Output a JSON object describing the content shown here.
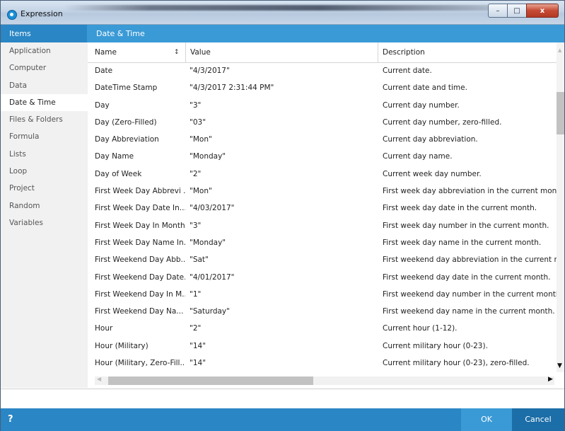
{
  "window": {
    "title": "Expression",
    "minimize_glyph": "–",
    "maximize_glyph": "□",
    "close_glyph": "x"
  },
  "header": {
    "items_label": "Items",
    "section_label": "Date & Time"
  },
  "sidebar": {
    "items": [
      {
        "label": "Application"
      },
      {
        "label": "Computer"
      },
      {
        "label": "Data"
      },
      {
        "label": "Date & Time"
      },
      {
        "label": "Files & Folders"
      },
      {
        "label": "Formula"
      },
      {
        "label": "Lists"
      },
      {
        "label": "Loop"
      },
      {
        "label": "Project"
      },
      {
        "label": "Random"
      },
      {
        "label": "Variables"
      }
    ],
    "selected": "Date & Time"
  },
  "table": {
    "columns": [
      "Name",
      "Value",
      "Description"
    ],
    "rows": [
      {
        "name": "Date",
        "value": "\"4/3/2017\"",
        "description": "Current date."
      },
      {
        "name": "DateTime Stamp",
        "value": "\"4/3/2017 2:31:44 PM\"",
        "description": "Current date and time."
      },
      {
        "name": "Day",
        "value": "\"3\"",
        "description": "Current day number."
      },
      {
        "name": "Day (Zero-Filled)",
        "value": "\"03\"",
        "description": "Current day number, zero-filled."
      },
      {
        "name": "Day Abbreviation",
        "value": "\"Mon\"",
        "description": "Current day abbreviation."
      },
      {
        "name": "Day Name",
        "value": "\"Monday\"",
        "description": "Current day name."
      },
      {
        "name": "Day of Week",
        "value": "\"2\"",
        "description": "Current week day number."
      },
      {
        "name": "First Week Day Abbrevi ...",
        "value": "\"Mon\"",
        "description": "First week day abbreviation in the current month."
      },
      {
        "name": "First Week Day Date In...",
        "value": "\"4/03/2017\"",
        "description": "First week day date in the current month."
      },
      {
        "name": "First Week Day In Month",
        "value": "\"3\"",
        "description": "First week day number in the current month."
      },
      {
        "name": "First Week Day Name In...",
        "value": "\"Monday\"",
        "description": "First week day name in the current month."
      },
      {
        "name": "First Weekend Day Abb...",
        "value": "\"Sat\"",
        "description": "First weekend day abbreviation in the current montl"
      },
      {
        "name": "First Weekend Day Date...",
        "value": "\"4/01/2017\"",
        "description": "First weekend day date in the current month."
      },
      {
        "name": "First Weekend Day In M...",
        "value": "\"1\"",
        "description": "First weekend day number in the current month."
      },
      {
        "name": "First Weekend Day Na...",
        "value": "\"Saturday\"",
        "description": "First weekend day name in the current month."
      },
      {
        "name": "Hour",
        "value": "\"2\"",
        "description": "Current hour (1-12)."
      },
      {
        "name": "Hour (Military)",
        "value": "\"14\"",
        "description": "Current military hour (0-23)."
      },
      {
        "name": "Hour (Military, Zero-Fill...",
        "value": "\"14\"",
        "description": "Current military hour (0-23), zero-filled."
      }
    ]
  },
  "footer": {
    "help_label": "?",
    "ok_label": "OK",
    "cancel_label": "Cancel"
  },
  "colors": {
    "header_blue": "#3a9ad6",
    "footer_blue": "#2a86c4",
    "cancel_blue": "#1c6ea8"
  }
}
